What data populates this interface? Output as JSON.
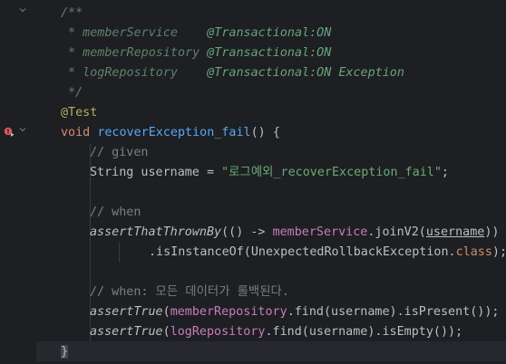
{
  "editor": {
    "lines": [
      {
        "id": "l1",
        "parts": [
          {
            "cls": "c-doc",
            "t": "/**"
          }
        ]
      },
      {
        "id": "l2",
        "parts": [
          {
            "cls": "c-doc",
            "t": " * memberService    "
          },
          {
            "cls": "c-doc-tag",
            "t": "@Transactional:ON"
          }
        ]
      },
      {
        "id": "l3",
        "parts": [
          {
            "cls": "c-doc",
            "t": " * memberRepository "
          },
          {
            "cls": "c-doc-tag",
            "t": "@Transactional:ON"
          }
        ]
      },
      {
        "id": "l4",
        "parts": [
          {
            "cls": "c-doc",
            "t": " * logRepository    "
          },
          {
            "cls": "c-doc-tag",
            "t": "@Transactional:ON Exception"
          }
        ]
      },
      {
        "id": "l5",
        "parts": [
          {
            "cls": "c-doc",
            "t": " */"
          }
        ]
      },
      {
        "id": "l6",
        "parts": [
          {
            "cls": "c-anno",
            "t": "@Test"
          }
        ]
      },
      {
        "id": "l7",
        "parts": [
          {
            "cls": "c-kw",
            "t": "void "
          },
          {
            "cls": "c-fn",
            "t": "recoverException_fail"
          },
          {
            "cls": "c-plain",
            "t": "() "
          },
          {
            "cls": "c-plain brace",
            "t": "{"
          }
        ]
      },
      {
        "id": "l8",
        "parts": [
          {
            "cls": "c-comment",
            "t": "// given"
          }
        ]
      },
      {
        "id": "l9",
        "parts": [
          {
            "cls": "c-plain",
            "t": "String username = "
          },
          {
            "cls": "c-str",
            "t": "\"로그예외_recoverException_fail\""
          },
          {
            "cls": "c-plain",
            "t": ";"
          }
        ]
      },
      {
        "id": "l10",
        "parts": []
      },
      {
        "id": "l11",
        "parts": [
          {
            "cls": "c-comment",
            "t": "// when"
          }
        ]
      },
      {
        "id": "l12",
        "parts": [
          {
            "cls": "c-plain c-static",
            "t": "assertThatThrownBy"
          },
          {
            "cls": "c-plain",
            "t": "(() -> "
          },
          {
            "cls": "c-field",
            "t": "memberService"
          },
          {
            "cls": "c-plain",
            "t": ".joinV2("
          },
          {
            "cls": "c-param",
            "t": "username"
          },
          {
            "cls": "c-plain",
            "t": "))"
          }
        ]
      },
      {
        "id": "l13",
        "parts": [
          {
            "cls": "c-plain",
            "t": ".isInstanceOf(UnexpectedRollbackException."
          },
          {
            "cls": "c-kw",
            "t": "class"
          },
          {
            "cls": "c-plain",
            "t": ");"
          }
        ]
      },
      {
        "id": "l14",
        "parts": []
      },
      {
        "id": "l15",
        "parts": [
          {
            "cls": "c-comment",
            "t": "// when: 모든 데이터가 롤백된다."
          }
        ]
      },
      {
        "id": "l16",
        "parts": [
          {
            "cls": "c-plain c-static",
            "t": "assertTrue"
          },
          {
            "cls": "c-plain",
            "t": "("
          },
          {
            "cls": "c-field",
            "t": "memberRepository"
          },
          {
            "cls": "c-plain",
            "t": ".find(username).isPresent());"
          }
        ]
      },
      {
        "id": "l17",
        "parts": [
          {
            "cls": "c-plain c-static",
            "t": "assertTrue"
          },
          {
            "cls": "c-plain",
            "t": "("
          },
          {
            "cls": "c-field",
            "t": "logRepository"
          },
          {
            "cls": "c-plain",
            "t": ".find(username).isEmpty());"
          }
        ]
      },
      {
        "id": "l18",
        "parts": [
          {
            "cls": "c-plain brace-match",
            "t": "}"
          }
        ]
      }
    ]
  },
  "gutter": {
    "fold_icon": "chevron-down-icon",
    "run_icon": "run-test-error-icon"
  },
  "colors": {
    "background": "#1e1f22",
    "current_line": "#26282e",
    "keyword": "#cf8e6d",
    "function": "#56a8f5",
    "string": "#6aab73",
    "field": "#c77dbb",
    "comment": "#7a7e85",
    "doc_comment": "#5f826b",
    "annotation": "#b3ae60",
    "error": "#db5c5c"
  }
}
